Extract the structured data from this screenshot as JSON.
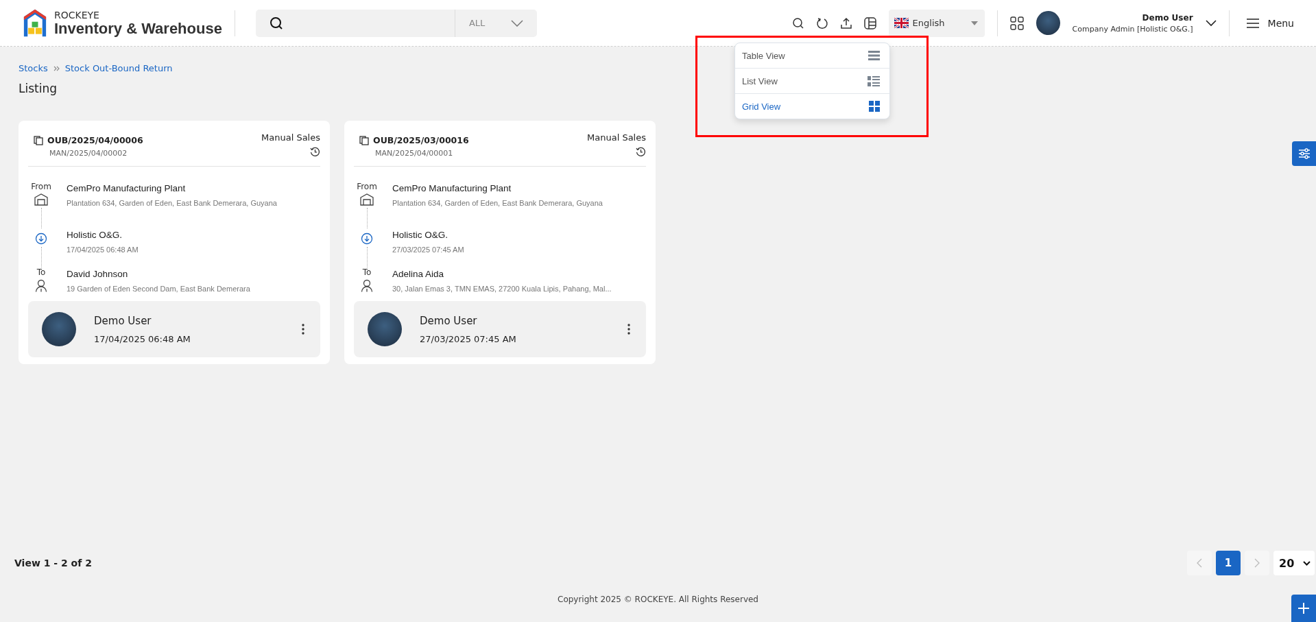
{
  "header": {
    "brand_small": "ROCKEYE",
    "brand_title": "Inventory & Warehouse",
    "search": {
      "scope": "ALL"
    },
    "language": "English",
    "user": {
      "name": "Demo User",
      "role": "Company Admin [Holistic O&G.]"
    },
    "menu_label": "Menu"
  },
  "breadcrumb": [
    {
      "label": "Stocks"
    },
    {
      "label": "Stock Out-Bound Return"
    }
  ],
  "page_title": "Listing",
  "view_menu": [
    {
      "label": "Table View",
      "kind": "table",
      "selected": false
    },
    {
      "label": "List View",
      "kind": "list",
      "selected": false
    },
    {
      "label": "Grid View",
      "kind": "grid",
      "selected": true
    }
  ],
  "cards": [
    {
      "number": "OUB/2025/04/00006",
      "reference": "MAN/2025/04/00002",
      "type": "Manual Sales",
      "from_label": "From",
      "from_name": "CemPro Manufacturing Plant",
      "from_address": "Plantation 634, Garden of Eden, East Bank Demerara, Guyana",
      "via_name": "Holistic O&G.",
      "via_time": "17/04/2025 06:48 AM",
      "to_label": "To",
      "to_name": "David Johnson",
      "to_address": "19 Garden of Eden Second Dam, East Bank Demerara",
      "user_name": "Demo User",
      "user_time": "17/04/2025 06:48 AM"
    },
    {
      "number": "OUB/2025/03/00016",
      "reference": "MAN/2025/04/00001",
      "type": "Manual Sales",
      "from_label": "From",
      "from_name": "CemPro Manufacturing Plant",
      "from_address": "Plantation 634, Garden of Eden, East Bank Demerara, Guyana",
      "via_name": "Holistic O&G.",
      "via_time": "27/03/2025 07:45 AM",
      "to_label": "To",
      "to_name": "Adelina Aida",
      "to_address": "30, Jalan Emas 3, TMN EMAS, 27200 Kuala Lipis, Pahang, Mal...",
      "user_name": "Demo User",
      "user_time": "27/03/2025 07:45 AM"
    }
  ],
  "pagination": {
    "summary": "View 1 - 2 of 2",
    "pages": [
      {
        "label": "1",
        "selected": true
      }
    ],
    "page_size": "20"
  },
  "footer": "Copyright 2025 © ROCKEYE. All Rights Reserved"
}
